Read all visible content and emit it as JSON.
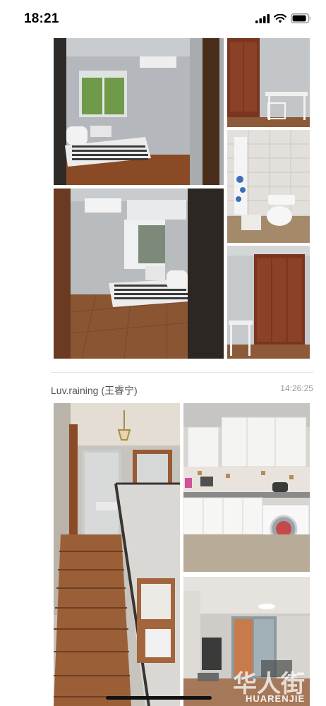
{
  "status_bar": {
    "time": "18:21",
    "icons": [
      "cellular-signal-icon",
      "wifi-icon",
      "battery-icon"
    ]
  },
  "feed": {
    "post_1": {
      "photos": [
        "bedroom-photo",
        "wardrobe-desk-photo",
        "bathroom-photo",
        "bedroom-wide-photo",
        "wardrobe-photo"
      ]
    },
    "post_2": {
      "author": "Luv.raining (王睿宁)",
      "time": "14:26:25",
      "photos": [
        "staircase-photo",
        "kitchen-photo",
        "living-room-photo"
      ]
    }
  },
  "watermark": {
    "logo": "华人街",
    "text": "HUARENJIE"
  },
  "colors": {
    "background": "#ffffff",
    "author_text": "#555555",
    "timestamp_text": "#9a9a9a",
    "divider": "#e4e4e4"
  }
}
